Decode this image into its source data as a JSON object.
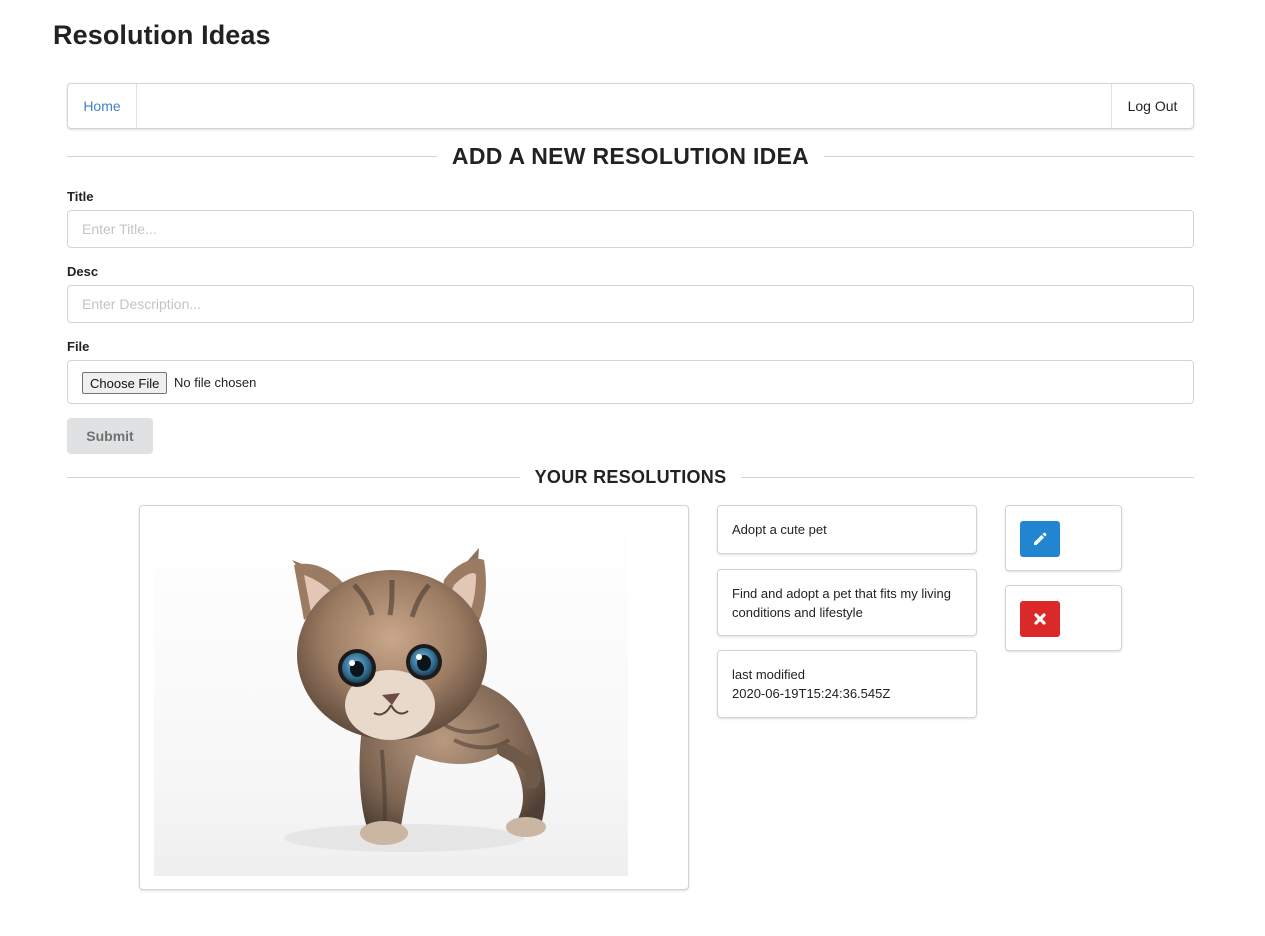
{
  "app": {
    "title": "Resolution Ideas"
  },
  "nav": {
    "home_label": "Home",
    "logout_label": "Log Out"
  },
  "form": {
    "heading": "ADD A NEW RESOLUTION IDEA",
    "title_label": "Title",
    "title_placeholder": "Enter Title...",
    "title_value": "",
    "desc_label": "Desc",
    "desc_placeholder": "Enter Description...",
    "desc_value": "",
    "file_label": "File",
    "choose_file_label": "Choose File",
    "file_status": "No file chosen",
    "submit_label": "Submit"
  },
  "resolutions": {
    "heading": "YOUR RESOLUTIONS",
    "items": [
      {
        "image": "kitten-photo",
        "title": "Adopt a cute pet",
        "description": "Find and adopt a pet that fits my living conditions and lifestyle",
        "modified_label": "last modified",
        "modified_value": "2020-06-19T15:24:36.545Z",
        "actions": [
          {
            "icon": "pencil-icon",
            "color": "#2185d0"
          },
          {
            "icon": "close-icon",
            "color": "#db2828"
          }
        ]
      }
    ]
  },
  "colors": {
    "link": "#4183c4",
    "edit_button": "#2185d0",
    "delete_button": "#db2828",
    "submit_button": "#e0e1e2",
    "border": "#d4d4d5"
  }
}
